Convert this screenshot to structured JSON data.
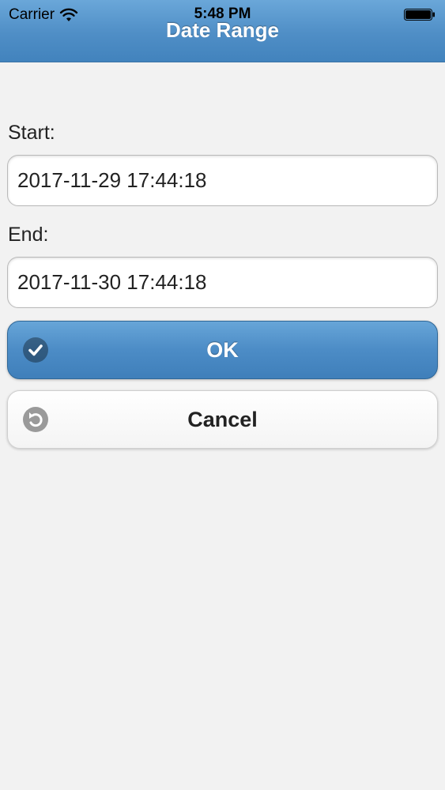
{
  "status_bar": {
    "carrier": "Carrier",
    "time": "5:48 PM",
    "icons": [
      "wifi-icon",
      "battery-icon"
    ]
  },
  "header": {
    "title": "Date Range"
  },
  "form": {
    "start": {
      "label": "Start:",
      "value": "2017-11-29 17:44:18"
    },
    "end": {
      "label": "End:",
      "value": "2017-11-30 17:44:18"
    }
  },
  "buttons": {
    "ok": {
      "label": "OK",
      "icon": "check-icon"
    },
    "cancel": {
      "label": "Cancel",
      "icon": "undo-icon"
    }
  },
  "colors": {
    "header_blue": "#4f8ec6",
    "ok_blue": "#4c8cc6",
    "background": "#f2f2f2"
  }
}
